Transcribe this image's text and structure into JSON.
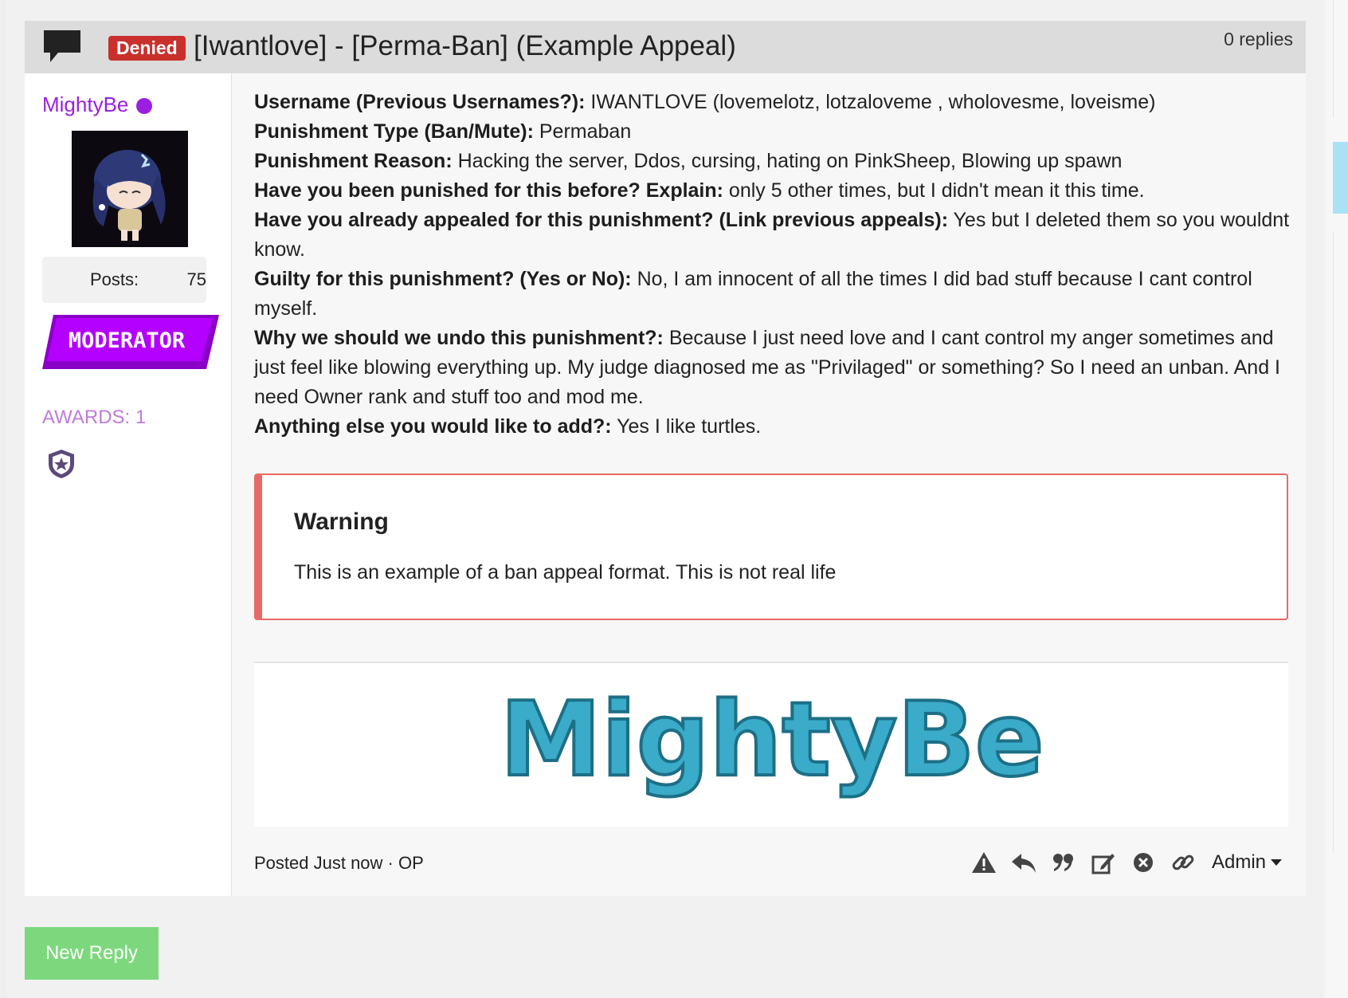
{
  "thread": {
    "status_badge": "Denied",
    "title": "[Iwantlove] - [Perma-Ban] (Example Appeal)",
    "replies": "0 replies"
  },
  "author": {
    "name": "MightyBe",
    "posts_label": "Posts:",
    "posts_value": "75",
    "rank_badge": "MODERATOR",
    "awards_label": "AWARDS: 1",
    "name_color": "#9b1fe0"
  },
  "post": {
    "fields": [
      {
        "label": "Username (Previous Usernames?):",
        "value": " IWANTLOVE (lovemelotz, lotzaloveme , wholovesme, loveisme)"
      },
      {
        "label": "Punishment Type (Ban/Mute):",
        "value": " Permaban"
      },
      {
        "label": "Punishment Reason:",
        "value": " Hacking the server, Ddos, cursing, hating on PinkSheep, Blowing up spawn"
      },
      {
        "label": "Have you been punished for this before? Explain:",
        "value": " only 5 other times, but I didn't mean it this time."
      },
      {
        "label": "Have you already appealed for this punishment? (Link previous appeals):",
        "value": " Yes but I deleted them so you wouldnt know."
      },
      {
        "label": "Guilty for this punishment? (Yes or No):",
        "value": " No, I am innocent of all the times I did bad stuff because I cant control myself."
      },
      {
        "label": "Why we should we undo this punishment?:",
        "value": " Because I just need love and I cant control my anger sometimes and just feel like blowing everything up. My judge diagnosed me as \"Privilaged\" or something? So I need an unban. And I need Owner rank and stuff too and mod me."
      },
      {
        "label": "Anything else you would like to add?:",
        "value": " Yes I like turtles."
      }
    ],
    "warning": {
      "title": "Warning",
      "text": "This is an example of a ban appeal format. This is not real life",
      "color": "#e86a67"
    },
    "signature_text": "MightyBe",
    "signature_color": "#3aabc9",
    "footer_posted": "Posted Just now · OP"
  },
  "actions": {
    "icons": [
      "report-icon",
      "reply-icon",
      "quote-icon",
      "edit-icon",
      "delete-icon",
      "link-icon"
    ],
    "admin_label": "Admin"
  },
  "new_reply_label": "New Reply",
  "new_reply_color": "#7dd87d"
}
